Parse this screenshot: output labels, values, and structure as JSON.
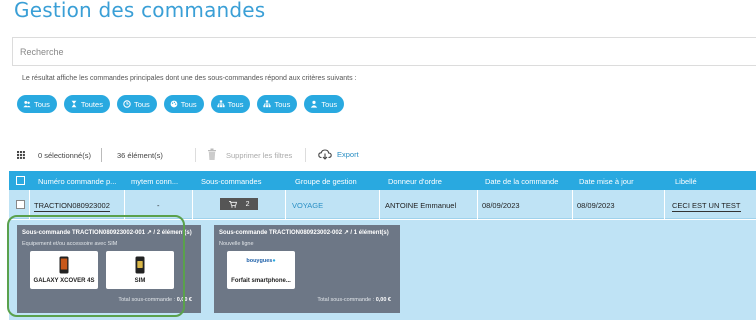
{
  "page": {
    "title": "Gestion des commandes"
  },
  "search": {
    "placeholder": "Recherche"
  },
  "info": "Le résultat affiche les commandes principales dont une des sous-commandes répond aux critères suivants :",
  "filters": [
    {
      "icon": "users-icon",
      "label": "Tous"
    },
    {
      "icon": "hourglass-icon",
      "label": "Toutes"
    },
    {
      "icon": "clock-icon",
      "label": "Tous"
    },
    {
      "icon": "palette-icon",
      "label": "Tous"
    },
    {
      "icon": "org-icon",
      "label": "Tous"
    },
    {
      "icon": "org-icon",
      "label": "Tous"
    },
    {
      "icon": "user-icon",
      "label": "Tous"
    }
  ],
  "toolbar": {
    "selected": "0 sélectionné(s)",
    "items": "36 élément(s)",
    "delete_filters": "Supprimer les filtres",
    "export": "Export"
  },
  "table": {
    "headers": [
      "Numéro commande p...",
      "mytem conn...",
      "Sous-commandes",
      "Groupe de gestion",
      "Donneur d'ordre",
      "Date de la commande",
      "Date mise à jour",
      "Libellé"
    ],
    "row": {
      "numero": "TRACTION080923002",
      "mytem": "-",
      "sous_commandes": "2",
      "groupe": "VOYAGE",
      "donneur": "ANTOINE Emmanuel",
      "date_commande": "08/09/2023",
      "date_maj": "08/09/2023",
      "libelle": "CECI EST UN TEST"
    }
  },
  "subcommands": [
    {
      "title": "Sous-commande TRACTION080923002-001",
      "count": "/ 2 élément(s)",
      "subtitle": "Equipement et/ou accessoire avec SIM",
      "products": [
        "GALAXY XCOVER 4S",
        "SIM"
      ],
      "total_label": "Total sous-commande :",
      "total_value": "0,00 €"
    },
    {
      "title": "Sous-commande TRACTION080923002-002",
      "count": "/ 1 élément(s)",
      "subtitle": "Nouvelle ligne",
      "products": [
        "Forfait smartphone..."
      ],
      "brand": "bouygues",
      "total_label": "Total sous-commande :",
      "total_value": "0,00 €"
    }
  ],
  "colors": {
    "accent": "#29a9e0",
    "title": "#3a9fd6",
    "row_bg": "#bfe3f5",
    "card_bg": "#6d7786",
    "highlight": "#5aa14c"
  }
}
